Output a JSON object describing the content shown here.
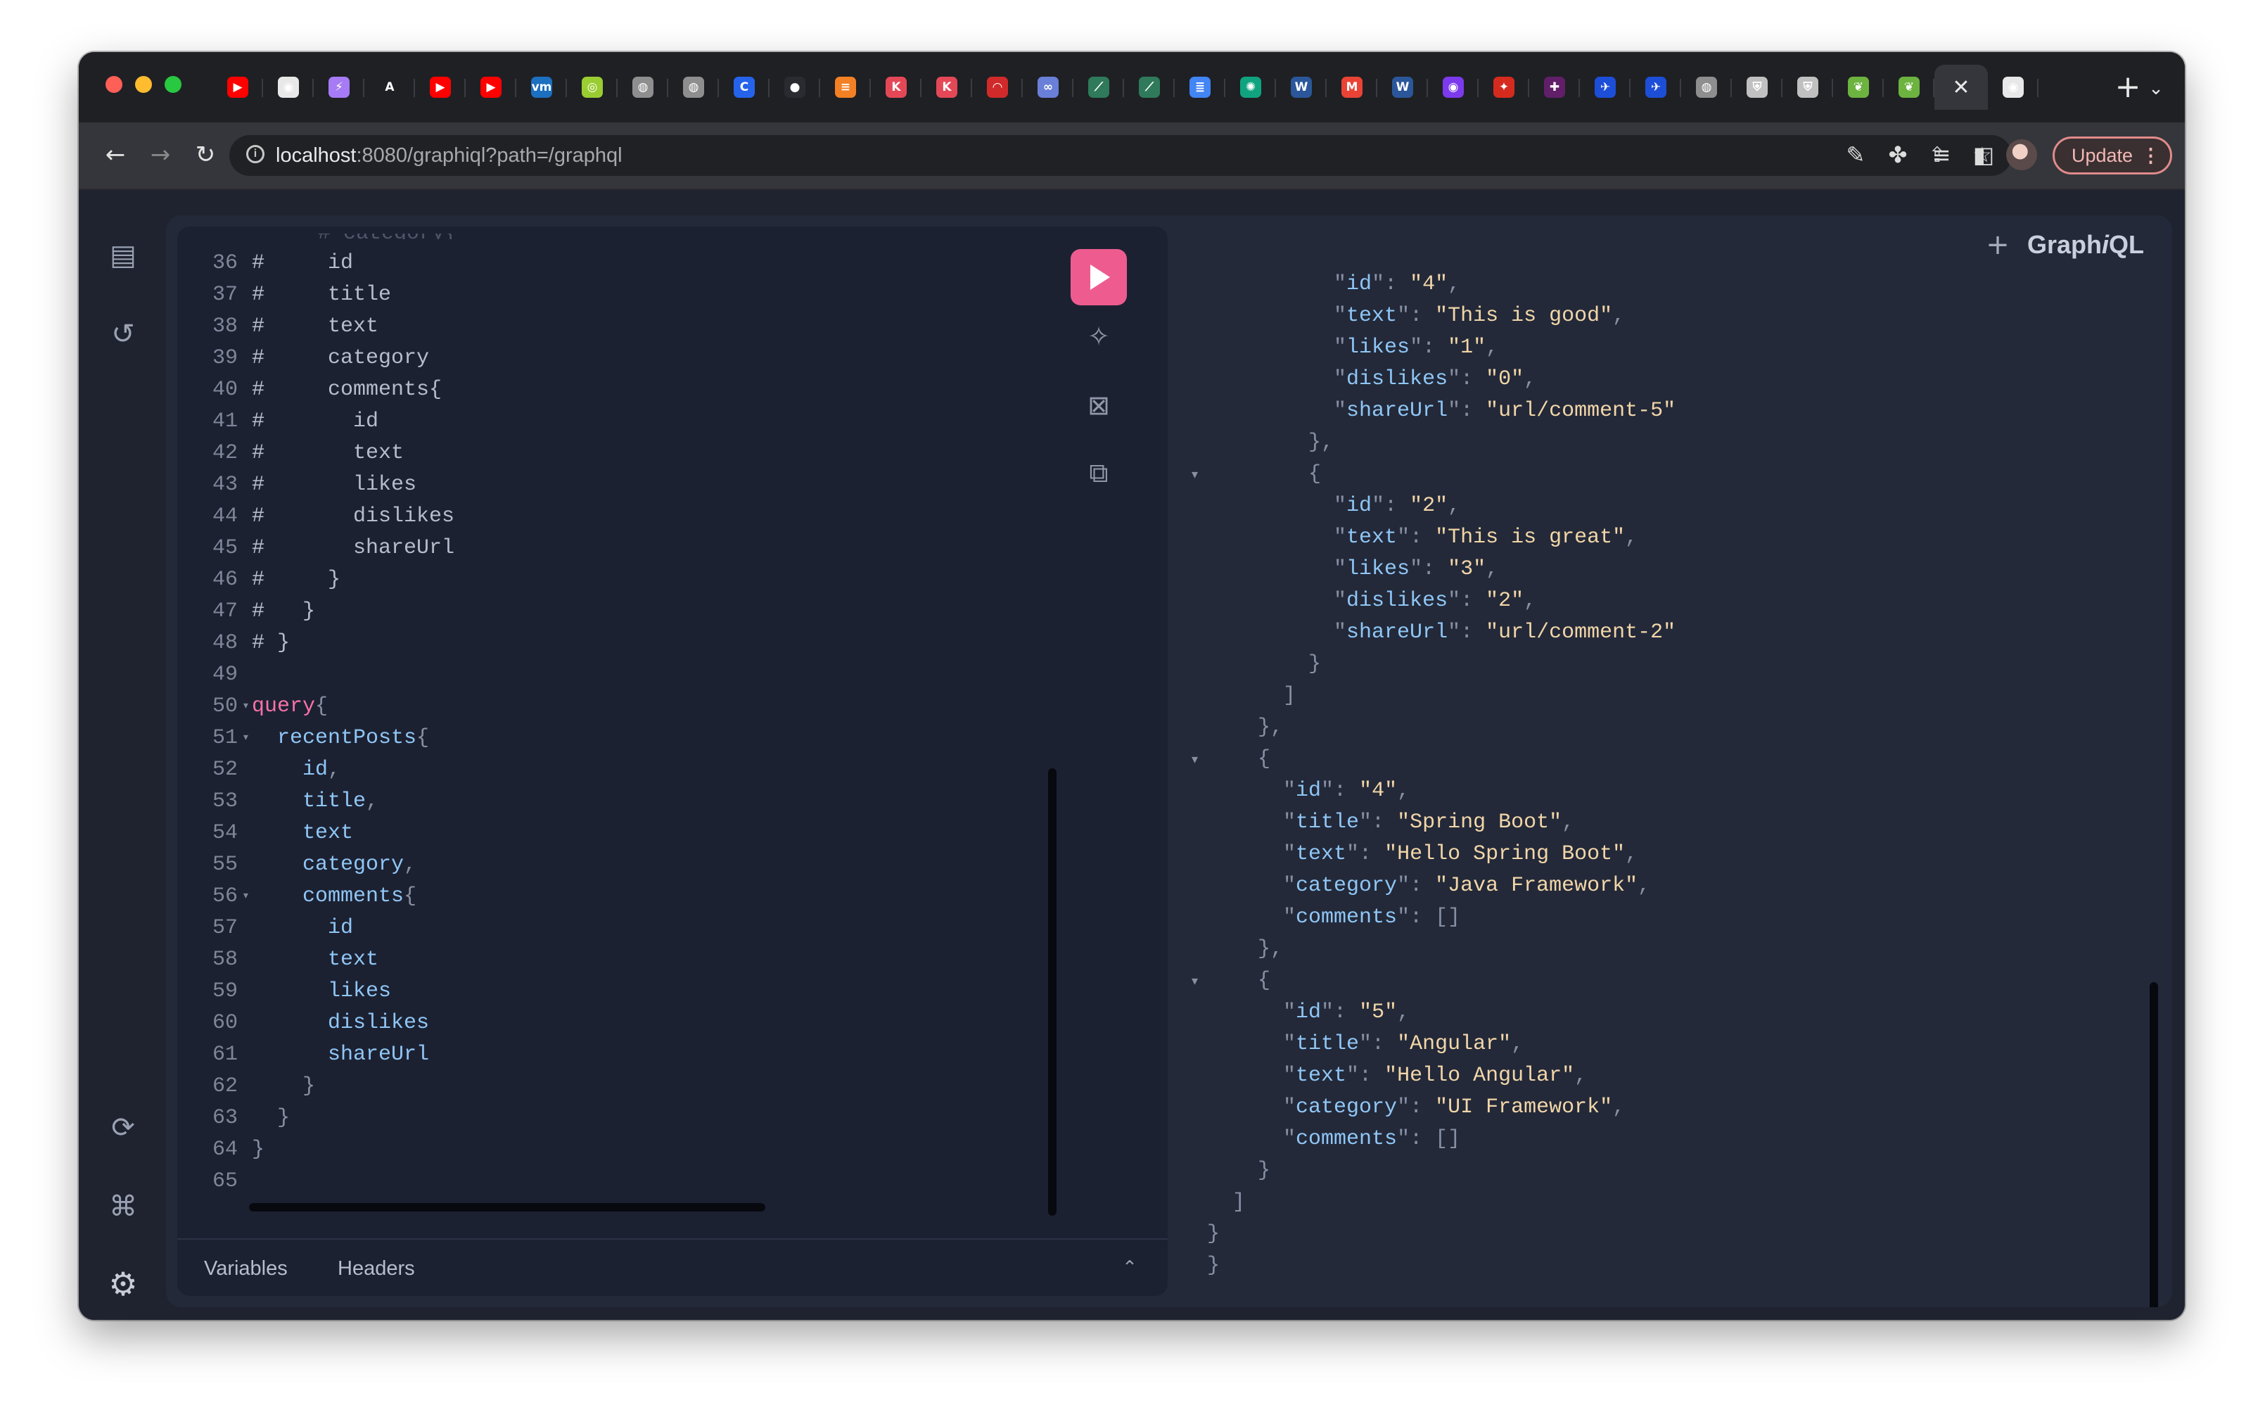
{
  "browser": {
    "new_tab_label": "+",
    "tab_menu_label": "⌄",
    "tabs": [
      {
        "icon": "youtube-icon",
        "glyph": "▶",
        "color": "#ff0000"
      },
      {
        "icon": "chrome-web-icon",
        "glyph": "◉",
        "color": "#e8e8e8"
      },
      {
        "icon": "vite-icon",
        "glyph": "⚡",
        "color": "#a67bf5"
      },
      {
        "icon": "letter-a-icon",
        "glyph": "A",
        "color": "#1f2024"
      },
      {
        "icon": "youtube-icon",
        "glyph": "▶",
        "color": "#ff0000"
      },
      {
        "icon": "youtube-icon",
        "glyph": "▶",
        "color": "#ff0000"
      },
      {
        "icon": "vmware-icon",
        "glyph": "vm",
        "color": "#1d6fbf"
      },
      {
        "icon": "green-app-icon",
        "glyph": "◎",
        "color": "#9acd32"
      },
      {
        "icon": "globe-icon",
        "glyph": "◍",
        "color": "#8e8e8e"
      },
      {
        "icon": "globe-icon",
        "glyph": "◍",
        "color": "#8e8e8e"
      },
      {
        "icon": "letter-c-icon",
        "glyph": "C",
        "color": "#2563eb"
      },
      {
        "icon": "github-dark-icon",
        "glyph": "●",
        "color": "#2a2b30"
      },
      {
        "icon": "stackoverflow-icon",
        "glyph": "≡",
        "color": "#f48024"
      },
      {
        "icon": "kotlin-icon",
        "glyph": "K",
        "color": "#e44857"
      },
      {
        "icon": "kotlin-icon",
        "glyph": "K",
        "color": "#e44857"
      },
      {
        "icon": "gauge-icon",
        "glyph": "◠",
        "color": "#d12a2a"
      },
      {
        "icon": "link-icon",
        "glyph": "∞",
        "color": "#6a7fd8"
      },
      {
        "icon": "leaf-dark-icon",
        "glyph": "⟋",
        "color": "#2f7a5a"
      },
      {
        "icon": "leaf-dark-icon",
        "glyph": "⟋",
        "color": "#2f7a5a"
      },
      {
        "icon": "docs-icon",
        "glyph": "≣",
        "color": "#4285f4"
      },
      {
        "icon": "openai-icon",
        "glyph": "✺",
        "color": "#10a37f"
      },
      {
        "icon": "word-icon",
        "glyph": "W",
        "color": "#2b579a"
      },
      {
        "icon": "gmail-icon",
        "glyph": "M",
        "color": "#ea4335"
      },
      {
        "icon": "word-icon",
        "glyph": "W",
        "color": "#2b579a"
      },
      {
        "icon": "purple-app-icon",
        "glyph": "◉",
        "color": "#7c3aed"
      },
      {
        "icon": "maple-leaf-icon",
        "glyph": "✦",
        "color": "#d52b1e"
      },
      {
        "icon": "slack-icon",
        "glyph": "✚",
        "color": "#611f69"
      },
      {
        "icon": "bird-icon",
        "glyph": "✈",
        "color": "#1d4ed8"
      },
      {
        "icon": "bird-icon",
        "glyph": "✈",
        "color": "#1d4ed8"
      },
      {
        "icon": "globe-icon",
        "glyph": "◍",
        "color": "#8e8e8e"
      },
      {
        "icon": "shield-icon",
        "glyph": "⛨",
        "color": "#c0c0c0"
      },
      {
        "icon": "shield-icon",
        "glyph": "⛨",
        "color": "#c0c0c0"
      },
      {
        "icon": "spring-icon",
        "glyph": "❦",
        "color": "#6db33f"
      },
      {
        "icon": "spring-icon",
        "glyph": "❦",
        "color": "#6db33f"
      },
      {
        "icon": "close-icon",
        "glyph": "✕",
        "color": "#35363b",
        "active": true
      },
      {
        "icon": "github-icon",
        "glyph": "◉",
        "color": "#e8e8e8"
      }
    ],
    "url_host": "localhost",
    "url_rest": ":8080/graphiql?path=/graphql",
    "update_label": "Update"
  },
  "graphiql": {
    "logo_text": "Graph",
    "logo_italic": "i",
    "logo_suffix": "QL",
    "add_tab_label": "+",
    "footer_tabs": [
      "Variables",
      "Headers"
    ],
    "query_lines": [
      {
        "n": "36",
        "parts": [
          {
            "t": "#     id",
            "c": "comment"
          }
        ]
      },
      {
        "n": "37",
        "parts": [
          {
            "t": "#     title",
            "c": "comment"
          }
        ]
      },
      {
        "n": "38",
        "parts": [
          {
            "t": "#     text",
            "c": "comment"
          }
        ]
      },
      {
        "n": "39",
        "parts": [
          {
            "t": "#     category",
            "c": "comment"
          }
        ]
      },
      {
        "n": "40",
        "parts": [
          {
            "t": "#     comments{",
            "c": "comment"
          }
        ]
      },
      {
        "n": "41",
        "parts": [
          {
            "t": "#       id",
            "c": "comment"
          }
        ]
      },
      {
        "n": "42",
        "parts": [
          {
            "t": "#       text",
            "c": "comment"
          }
        ]
      },
      {
        "n": "43",
        "parts": [
          {
            "t": "#       likes",
            "c": "comment"
          }
        ]
      },
      {
        "n": "44",
        "parts": [
          {
            "t": "#       dislikes",
            "c": "comment"
          }
        ]
      },
      {
        "n": "45",
        "parts": [
          {
            "t": "#       shareUrl",
            "c": "comment"
          }
        ]
      },
      {
        "n": "46",
        "parts": [
          {
            "t": "#     }",
            "c": "comment"
          }
        ]
      },
      {
        "n": "47",
        "parts": [
          {
            "t": "#   }",
            "c": "comment"
          }
        ]
      },
      {
        "n": "48",
        "parts": [
          {
            "t": "# }",
            "c": "comment"
          }
        ]
      },
      {
        "n": "49",
        "parts": []
      },
      {
        "n": "50",
        "fold": true,
        "parts": [
          {
            "t": "query",
            "c": "keyword"
          },
          {
            "t": "{",
            "c": "punct"
          }
        ]
      },
      {
        "n": "51",
        "fold": true,
        "parts": [
          {
            "t": "  recentPosts",
            "c": "field"
          },
          {
            "t": "{",
            "c": "punct"
          }
        ]
      },
      {
        "n": "52",
        "parts": [
          {
            "t": "    id",
            "c": "field"
          },
          {
            "t": ",",
            "c": "punct"
          }
        ]
      },
      {
        "n": "53",
        "parts": [
          {
            "t": "    title",
            "c": "field"
          },
          {
            "t": ",",
            "c": "punct"
          }
        ]
      },
      {
        "n": "54",
        "parts": [
          {
            "t": "    text",
            "c": "field"
          }
        ]
      },
      {
        "n": "55",
        "parts": [
          {
            "t": "    category",
            "c": "field"
          },
          {
            "t": ",",
            "c": "punct"
          }
        ]
      },
      {
        "n": "56",
        "fold": true,
        "parts": [
          {
            "t": "    comments",
            "c": "field"
          },
          {
            "t": "{",
            "c": "punct"
          }
        ]
      },
      {
        "n": "57",
        "parts": [
          {
            "t": "      id",
            "c": "field"
          }
        ]
      },
      {
        "n": "58",
        "parts": [
          {
            "t": "      text",
            "c": "field"
          }
        ]
      },
      {
        "n": "59",
        "parts": [
          {
            "t": "      likes",
            "c": "field"
          }
        ]
      },
      {
        "n": "60",
        "parts": [
          {
            "t": "      dislikes",
            "c": "field"
          }
        ]
      },
      {
        "n": "61",
        "parts": [
          {
            "t": "      shareUrl",
            "c": "field"
          }
        ]
      },
      {
        "n": "62",
        "parts": [
          {
            "t": "    }",
            "c": "punct"
          }
        ]
      },
      {
        "n": "63",
        "parts": [
          {
            "t": "  }",
            "c": "punct"
          }
        ]
      },
      {
        "n": "64",
        "parts": [
          {
            "t": "}",
            "c": "punct"
          }
        ]
      },
      {
        "n": "65",
        "parts": []
      }
    ],
    "result_lines": [
      {
        "parts": [
          {
            "t": "          \"",
            "c": "punct"
          },
          {
            "t": "id",
            "c": "key"
          },
          {
            "t": "\": ",
            "c": "punct"
          },
          {
            "t": "\"4\"",
            "c": "str"
          },
          {
            "t": ",",
            "c": "punct"
          }
        ]
      },
      {
        "parts": [
          {
            "t": "          \"",
            "c": "punct"
          },
          {
            "t": "text",
            "c": "key"
          },
          {
            "t": "\": ",
            "c": "punct"
          },
          {
            "t": "\"This is good\"",
            "c": "str"
          },
          {
            "t": ",",
            "c": "punct"
          }
        ]
      },
      {
        "parts": [
          {
            "t": "          \"",
            "c": "punct"
          },
          {
            "t": "likes",
            "c": "key"
          },
          {
            "t": "\": ",
            "c": "punct"
          },
          {
            "t": "\"1\"",
            "c": "str"
          },
          {
            "t": ",",
            "c": "punct"
          }
        ]
      },
      {
        "parts": [
          {
            "t": "          \"",
            "c": "punct"
          },
          {
            "t": "dislikes",
            "c": "key"
          },
          {
            "t": "\": ",
            "c": "punct"
          },
          {
            "t": "\"0\"",
            "c": "str"
          },
          {
            "t": ",",
            "c": "punct"
          }
        ]
      },
      {
        "parts": [
          {
            "t": "          \"",
            "c": "punct"
          },
          {
            "t": "shareUrl",
            "c": "key"
          },
          {
            "t": "\": ",
            "c": "punct"
          },
          {
            "t": "\"url/comment-5\"",
            "c": "str"
          }
        ]
      },
      {
        "parts": [
          {
            "t": "        },",
            "c": "punct"
          }
        ]
      },
      {
        "fold": true,
        "parts": [
          {
            "t": "        {",
            "c": "punct"
          }
        ]
      },
      {
        "parts": [
          {
            "t": "          \"",
            "c": "punct"
          },
          {
            "t": "id",
            "c": "key"
          },
          {
            "t": "\": ",
            "c": "punct"
          },
          {
            "t": "\"2\"",
            "c": "str"
          },
          {
            "t": ",",
            "c": "punct"
          }
        ]
      },
      {
        "parts": [
          {
            "t": "          \"",
            "c": "punct"
          },
          {
            "t": "text",
            "c": "key"
          },
          {
            "t": "\": ",
            "c": "punct"
          },
          {
            "t": "\"This is great\"",
            "c": "str"
          },
          {
            "t": ",",
            "c": "punct"
          }
        ]
      },
      {
        "parts": [
          {
            "t": "          \"",
            "c": "punct"
          },
          {
            "t": "likes",
            "c": "key"
          },
          {
            "t": "\": ",
            "c": "punct"
          },
          {
            "t": "\"3\"",
            "c": "str"
          },
          {
            "t": ",",
            "c": "punct"
          }
        ]
      },
      {
        "parts": [
          {
            "t": "          \"",
            "c": "punct"
          },
          {
            "t": "dislikes",
            "c": "key"
          },
          {
            "t": "\": ",
            "c": "punct"
          },
          {
            "t": "\"2\"",
            "c": "str"
          },
          {
            "t": ",",
            "c": "punct"
          }
        ]
      },
      {
        "parts": [
          {
            "t": "          \"",
            "c": "punct"
          },
          {
            "t": "shareUrl",
            "c": "key"
          },
          {
            "t": "\": ",
            "c": "punct"
          },
          {
            "t": "\"url/comment-2\"",
            "c": "str"
          }
        ]
      },
      {
        "parts": [
          {
            "t": "        }",
            "c": "punct"
          }
        ]
      },
      {
        "parts": [
          {
            "t": "      ]",
            "c": "punct"
          }
        ]
      },
      {
        "parts": [
          {
            "t": "    },",
            "c": "punct"
          }
        ]
      },
      {
        "fold": true,
        "parts": [
          {
            "t": "    {",
            "c": "punct"
          }
        ]
      },
      {
        "parts": [
          {
            "t": "      \"",
            "c": "punct"
          },
          {
            "t": "id",
            "c": "key"
          },
          {
            "t": "\": ",
            "c": "punct"
          },
          {
            "t": "\"4\"",
            "c": "str"
          },
          {
            "t": ",",
            "c": "punct"
          }
        ]
      },
      {
        "parts": [
          {
            "t": "      \"",
            "c": "punct"
          },
          {
            "t": "title",
            "c": "key"
          },
          {
            "t": "\": ",
            "c": "punct"
          },
          {
            "t": "\"Spring Boot\"",
            "c": "str"
          },
          {
            "t": ",",
            "c": "punct"
          }
        ]
      },
      {
        "parts": [
          {
            "t": "      \"",
            "c": "punct"
          },
          {
            "t": "text",
            "c": "key"
          },
          {
            "t": "\": ",
            "c": "punct"
          },
          {
            "t": "\"Hello Spring Boot\"",
            "c": "str"
          },
          {
            "t": ",",
            "c": "punct"
          }
        ]
      },
      {
        "parts": [
          {
            "t": "      \"",
            "c": "punct"
          },
          {
            "t": "category",
            "c": "key"
          },
          {
            "t": "\": ",
            "c": "punct"
          },
          {
            "t": "\"Java Framework\"",
            "c": "str"
          },
          {
            "t": ",",
            "c": "punct"
          }
        ]
      },
      {
        "parts": [
          {
            "t": "      \"",
            "c": "punct"
          },
          {
            "t": "comments",
            "c": "key"
          },
          {
            "t": "\": []",
            "c": "punct"
          }
        ]
      },
      {
        "parts": [
          {
            "t": "    },",
            "c": "punct"
          }
        ]
      },
      {
        "fold": true,
        "parts": [
          {
            "t": "    {",
            "c": "punct"
          }
        ]
      },
      {
        "parts": [
          {
            "t": "      \"",
            "c": "punct"
          },
          {
            "t": "id",
            "c": "key"
          },
          {
            "t": "\": ",
            "c": "punct"
          },
          {
            "t": "\"5\"",
            "c": "str"
          },
          {
            "t": ",",
            "c": "punct"
          }
        ]
      },
      {
        "parts": [
          {
            "t": "      \"",
            "c": "punct"
          },
          {
            "t": "title",
            "c": "key"
          },
          {
            "t": "\": ",
            "c": "punct"
          },
          {
            "t": "\"Angular\"",
            "c": "str"
          },
          {
            "t": ",",
            "c": "punct"
          }
        ]
      },
      {
        "parts": [
          {
            "t": "      \"",
            "c": "punct"
          },
          {
            "t": "text",
            "c": "key"
          },
          {
            "t": "\": ",
            "c": "punct"
          },
          {
            "t": "\"Hello Angular\"",
            "c": "str"
          },
          {
            "t": ",",
            "c": "punct"
          }
        ]
      },
      {
        "parts": [
          {
            "t": "      \"",
            "c": "punct"
          },
          {
            "t": "category",
            "c": "key"
          },
          {
            "t": "\": ",
            "c": "punct"
          },
          {
            "t": "\"UI Framework\"",
            "c": "str"
          },
          {
            "t": ",",
            "c": "punct"
          }
        ]
      },
      {
        "parts": [
          {
            "t": "      \"",
            "c": "punct"
          },
          {
            "t": "comments",
            "c": "key"
          },
          {
            "t": "\": []",
            "c": "punct"
          }
        ]
      },
      {
        "parts": [
          {
            "t": "    }",
            "c": "punct"
          }
        ]
      },
      {
        "parts": [
          {
            "t": "  ]",
            "c": "punct"
          }
        ]
      },
      {
        "parts": [
          {
            "t": "}",
            "c": "punct"
          }
        ]
      },
      {
        "parts": [
          {
            "t": "}",
            "c": "punct"
          }
        ]
      }
    ]
  },
  "colors": {
    "accent": "#ee5c8f",
    "keyword": "#f772a8",
    "field": "#8fc6f5",
    "string": "#f2d6a8",
    "background": "#1f2330"
  }
}
